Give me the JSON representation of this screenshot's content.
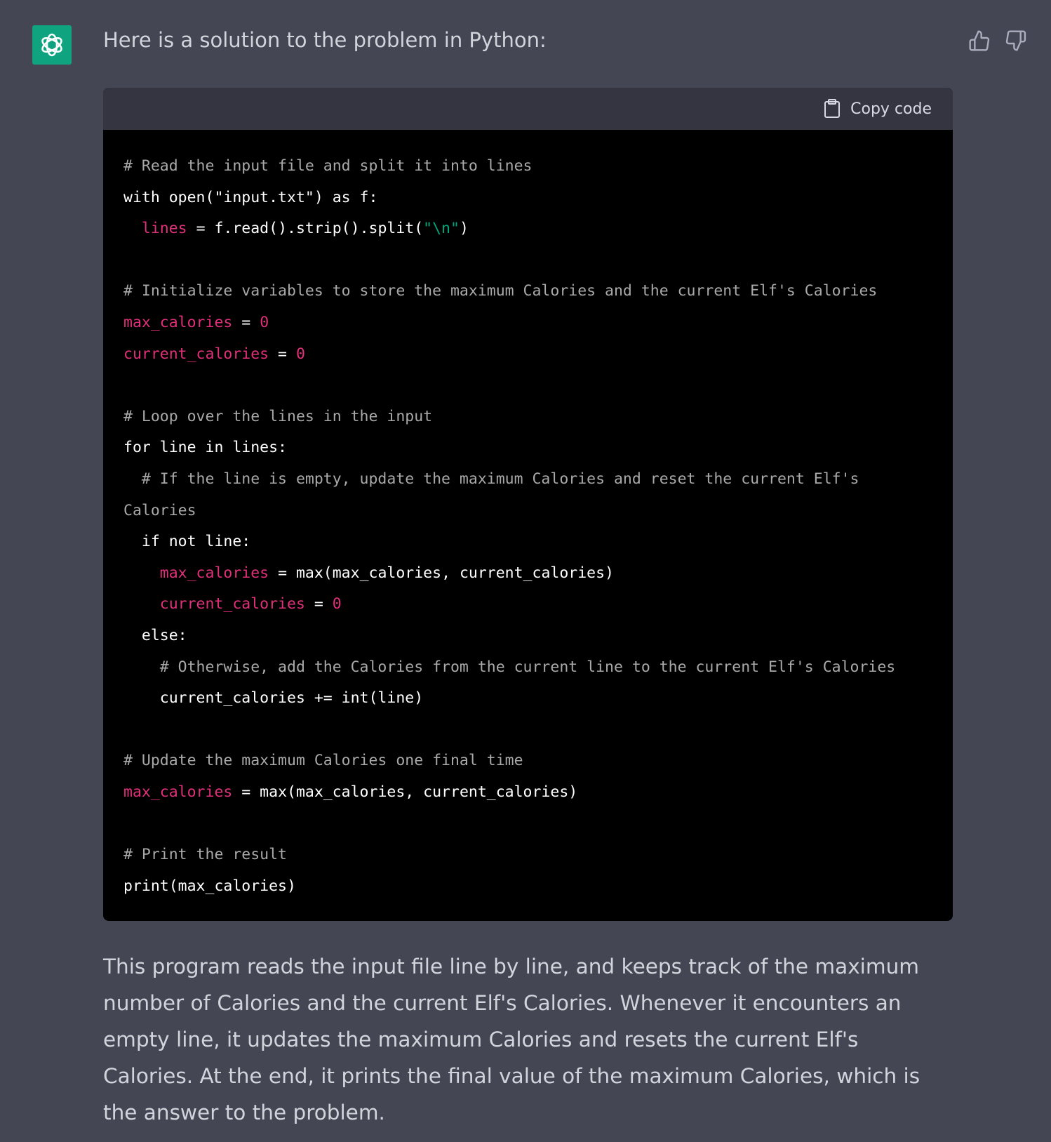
{
  "message": {
    "intro": "Here is a solution to the problem in Python:",
    "copy_label": "Copy code",
    "code_lines": [
      [
        {
          "t": "# Read the input file and split it into lines",
          "k": "c"
        }
      ],
      [
        {
          "t": "with open(\"input.txt\") as f:",
          "k": ""
        }
      ],
      [
        {
          "t": "  ",
          "k": ""
        },
        {
          "t": "lines",
          "k": "v"
        },
        {
          "t": " = f.read().strip().split(",
          "k": ""
        },
        {
          "t": "\"\\n\"",
          "k": "s"
        },
        {
          "t": ")",
          "k": ""
        }
      ],
      [],
      [
        {
          "t": "# Initialize variables to store the maximum Calories and the current Elf's Calories",
          "k": "c"
        }
      ],
      [
        {
          "t": "max_calories",
          "k": "v"
        },
        {
          "t": " = ",
          "k": ""
        },
        {
          "t": "0",
          "k": "v"
        }
      ],
      [
        {
          "t": "current_calories",
          "k": "v"
        },
        {
          "t": " = ",
          "k": ""
        },
        {
          "t": "0",
          "k": "v"
        }
      ],
      [],
      [
        {
          "t": "# Loop over the lines in the input",
          "k": "c"
        }
      ],
      [
        {
          "t": "for line in lines:",
          "k": ""
        }
      ],
      [
        {
          "t": "  # If the line is empty, update the maximum Calories and reset the current Elf's",
          "k": "c"
        }
      ],
      [
        {
          "t": "Calories",
          "k": "c"
        }
      ],
      [
        {
          "t": "  if not line:",
          "k": ""
        }
      ],
      [
        {
          "t": "    ",
          "k": ""
        },
        {
          "t": "max_calories",
          "k": "v"
        },
        {
          "t": " = max(max_calories, current_calories)",
          "k": ""
        }
      ],
      [
        {
          "t": "    ",
          "k": ""
        },
        {
          "t": "current_calories",
          "k": "v"
        },
        {
          "t": " = ",
          "k": ""
        },
        {
          "t": "0",
          "k": "v"
        }
      ],
      [
        {
          "t": "  else:",
          "k": ""
        }
      ],
      [
        {
          "t": "    # Otherwise, add the Calories from the current line to the current Elf's Calories",
          "k": "c"
        }
      ],
      [
        {
          "t": "    current_calories += int(line)",
          "k": ""
        }
      ],
      [],
      [
        {
          "t": "# Update the maximum Calories one final time",
          "k": "c"
        }
      ],
      [
        {
          "t": "max_calories",
          "k": "v"
        },
        {
          "t": " = max(max_calories, current_calories)",
          "k": ""
        }
      ],
      [],
      [
        {
          "t": "# Print the result",
          "k": "c"
        }
      ],
      [
        {
          "t": "print(max_calories)",
          "k": ""
        }
      ]
    ],
    "summary": "This program reads the input file line by line, and keeps track of the maximum number of Calories and the current Elf's Calories. Whenever it encounters an empty line, it updates the maximum Calories and resets the current Elf's Calories. At the end, it prints the final value of the maximum Calories, which is the answer to the problem."
  },
  "colors": {
    "brand": "#10a37f",
    "keyword_var": "#df3079",
    "string": "#00a67d"
  }
}
